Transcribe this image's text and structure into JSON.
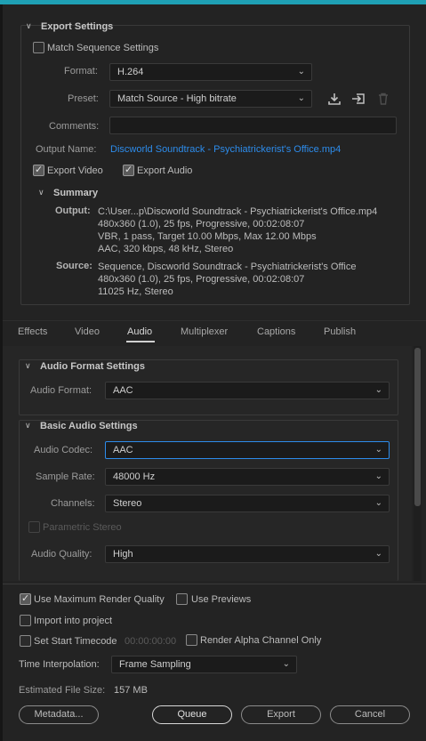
{
  "export_settings": {
    "header": "Export Settings",
    "match_sequence_label": "Match Sequence Settings",
    "format_label": "Format:",
    "format_value": "H.264",
    "preset_label": "Preset:",
    "preset_value": "Match Source - High bitrate",
    "comments_label": "Comments:",
    "comments_value": "",
    "output_name_label": "Output Name:",
    "output_name_value": "Discworld Soundtrack - Psychiatrickerist's Office.mp4",
    "export_video_label": "Export Video",
    "export_audio_label": "Export Audio",
    "icons": [
      "save-preset-icon",
      "import-preset-icon",
      "delete-preset-icon"
    ]
  },
  "summary": {
    "header": "Summary",
    "output_label": "Output:",
    "output_lines": [
      "C:\\User...p\\Discworld Soundtrack - Psychiatrickerist's Office.mp4",
      "480x360 (1.0), 25 fps, Progressive, 00:02:08:07",
      "VBR, 1 pass, Target 10.00 Mbps, Max 12.00 Mbps",
      "AAC, 320 kbps, 48 kHz, Stereo"
    ],
    "source_label": "Source:",
    "source_lines": [
      "Sequence, Discworld Soundtrack - Psychiatrickerist's Office",
      "480x360 (1.0), 25 fps, Progressive, 00:02:08:07",
      "11025 Hz, Stereo"
    ]
  },
  "tabs": [
    "Effects",
    "Video",
    "Audio",
    "Multiplexer",
    "Captions",
    "Publish"
  ],
  "active_tab": "Audio",
  "audio_format": {
    "header": "Audio Format Settings",
    "format_label": "Audio Format:",
    "format_value": "AAC"
  },
  "basic_audio": {
    "header": "Basic Audio Settings",
    "codec_label": "Audio Codec:",
    "codec_value": "AAC",
    "sample_rate_label": "Sample Rate:",
    "sample_rate_value": "48000 Hz",
    "channels_label": "Channels:",
    "channels_value": "Stereo",
    "parametric_label": "Parametric Stereo",
    "quality_label": "Audio Quality:",
    "quality_value": "High"
  },
  "bottom": {
    "max_render_label": "Use Maximum Render Quality",
    "use_previews_label": "Use Previews",
    "import_label": "Import into project",
    "start_tc_label": "Set Start Timecode",
    "start_tc_value": "00:00:00:00",
    "alpha_label": "Render Alpha Channel Only",
    "interp_label": "Time Interpolation:",
    "interp_value": "Frame Sampling",
    "file_size_label": "Estimated File Size:",
    "file_size_value": "157 MB",
    "metadata_btn": "Metadata...",
    "queue_btn": "Queue",
    "export_btn": "Export",
    "cancel_btn": "Cancel"
  },
  "colors": {
    "accent": "#2d8ceb",
    "top_strip": "#1fa0b4",
    "bg": "#232323"
  }
}
